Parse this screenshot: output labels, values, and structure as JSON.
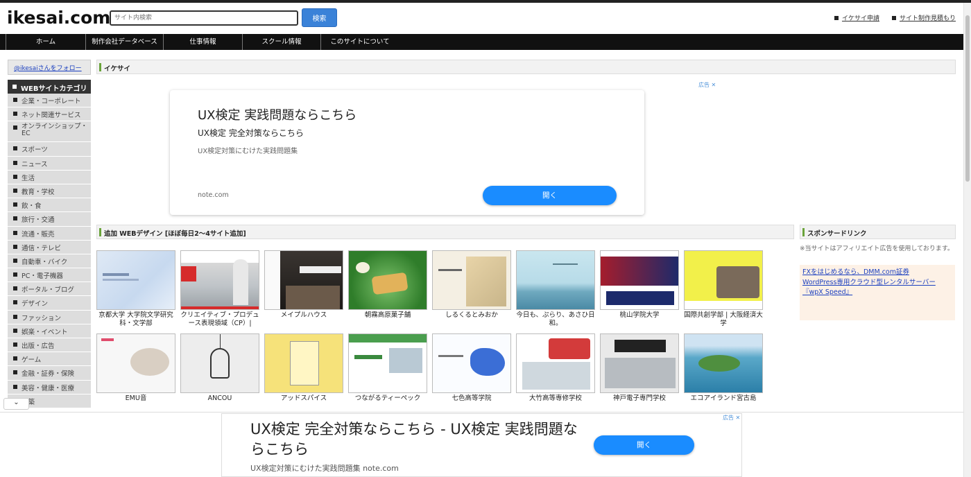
{
  "header": {
    "logo": "ikesai.com",
    "search_placeholder": "サイト内検索",
    "search_button": "検索",
    "links": [
      "イケサイ申請",
      "サイト制作見積もり"
    ]
  },
  "nav": [
    "ホーム",
    "制作会社データベース",
    "仕事情報",
    "スクール情報",
    "このサイトについて"
  ],
  "sidebar": {
    "follow": "@ikesaiさんをフォロー",
    "category_title": "WEBサイトカテゴリ",
    "categories": [
      "企業・コーポレート",
      "ネット関連サービス",
      "オンラインショップ・EC",
      "スポーツ",
      "ニュース",
      "生活",
      "教育・学校",
      "飲・食",
      "旅行・交通",
      "流通・販売",
      "通信・テレビ",
      "自動車・バイク",
      "PC・電子機器",
      "ポータル・ブログ",
      "デザイン",
      "ファッション",
      "娯楽・イベント",
      "出版・広告",
      "ゲーム",
      "金融・証券・保険",
      "美容・健康・医療",
      "建築"
    ]
  },
  "sections": {
    "ikesai": "イケサイ",
    "added": "追加 WEBデザイン [ほぼ毎日2〜4サイト追加]",
    "sponsored": "スポンサードリンク"
  },
  "top_ad": {
    "mark": "広告",
    "title": "UX検定 実践問題ならこちら",
    "subtitle": "UX検定 完全対策ならこちら",
    "desc": "UX検定対策にむけた実践問題集",
    "domain": "note.com",
    "button": "開く"
  },
  "sites": [
    [
      "京都大学 大学院文学研究科・文学部",
      "クリエイティブ・プロデュース表現領域（CP）|",
      "メイプルハウス",
      "朝霧高原菓子舗",
      "しるくるとみおか",
      "今日も、ぷらり、あさひ日和。",
      "桃山学院大学",
      "国際共創学部 | 大阪経済大学"
    ],
    [
      "EMU音",
      "ANCOU",
      "アッドスパイス",
      "つながるティーペック",
      "七色高等学院",
      "大竹高等専修学校",
      "神戸電子専門学校",
      "エコアイランド宮古島"
    ]
  ],
  "sponsored": {
    "note": "※当サイトはアフィリエイト広告を使用しております。",
    "links": [
      "FXをはじめるなら、DMM.com証券",
      "WordPress専用クラウド型レンタルサーバー『wpX Speed』"
    ]
  },
  "bottom_ad": {
    "mark": "広告",
    "title": "UX検定 完全対策ならこちら - UX検定 実践問題ならこちら",
    "desc": "UX検定対策にむけた実践問題集 note.com",
    "button": "開く"
  },
  "colors": {
    "accent": "#3a82d8",
    "nav_bg": "#111111",
    "section_marker": "#6aa33a",
    "ad_button": "#1a8cff"
  }
}
